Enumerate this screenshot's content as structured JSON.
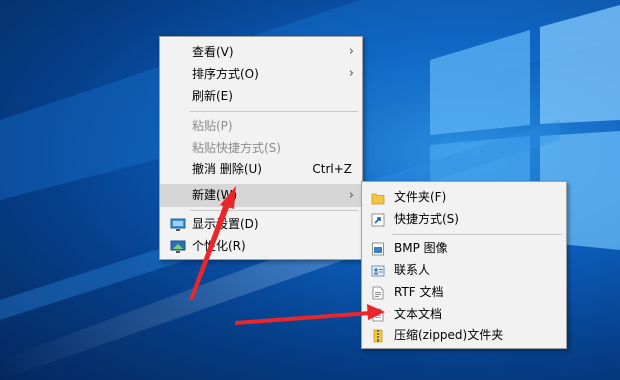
{
  "context_menu": {
    "items": [
      {
        "label": "查看(V)",
        "submenu": true
      },
      {
        "label": "排序方式(O)",
        "submenu": true
      },
      {
        "label": "刷新(E)"
      },
      {
        "label": "粘贴(P)",
        "disabled": true
      },
      {
        "label": "粘贴快捷方式(S)",
        "disabled": true
      },
      {
        "label": "撤消 删除(U)",
        "shortcut": "Ctrl+Z"
      },
      {
        "label": "新建(W)",
        "submenu": true,
        "highlighted": true
      },
      {
        "label": "显示设置(D)",
        "icon": "display-settings-icon"
      },
      {
        "label": "个性化(R)",
        "icon": "personalize-icon"
      }
    ]
  },
  "new_submenu": {
    "items": [
      {
        "label": "文件夹(F)",
        "icon": "folder-icon"
      },
      {
        "label": "快捷方式(S)",
        "icon": "shortcut-icon"
      },
      {
        "label": "BMP 图像",
        "icon": "bmp-image-icon"
      },
      {
        "label": "联系人",
        "icon": "contact-icon"
      },
      {
        "label": "RTF 文档",
        "icon": "rtf-document-icon"
      },
      {
        "label": "文本文档",
        "icon": "text-document-icon"
      },
      {
        "label": "压缩(zipped)文件夹",
        "icon": "zip-folder-icon"
      }
    ]
  },
  "colors": {
    "menu_bg": "#f2f2f2",
    "hover_bg": "#d6d6d6",
    "annotation_arrow": "#e8262b"
  }
}
